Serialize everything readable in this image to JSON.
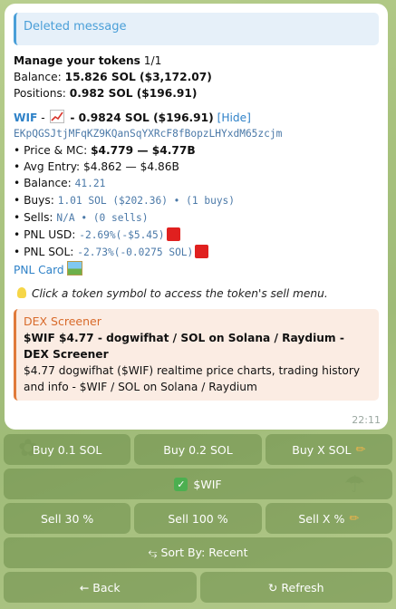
{
  "reply": {
    "text": "Deleted message"
  },
  "manage": {
    "title": "Manage your tokens",
    "pages": "1/1"
  },
  "balance": {
    "label": "Balance:",
    "value": "15.826 SOL ($3,172.07)"
  },
  "positions": {
    "label": "Positions:",
    "value": "0.982 SOL ($196.91)"
  },
  "token": {
    "symbol": "WIF",
    "dash": "-",
    "chart_icon": "chart-increasing-icon",
    "amount": "- 0.9824 SOL ($196.91)",
    "hide": "[Hide]",
    "address": "EKpQGSJtjMFqKZ9KQanSqYXRcF8fBopzLHYxdM65zcjm",
    "price_label": "• Price & MC:",
    "price_value": "$4.779 — $4.77B",
    "avg_label": "• Avg Entry:",
    "avg_value": "$4.862 — $4.86B",
    "bal_label": "• Balance:",
    "bal_value": "41.21",
    "buys_label": "• Buys:",
    "buys_value": "1.01 SOL ($202.36) • (1 buys)",
    "sells_label": "• Sells:",
    "sells_value": "N/A • (0 sells)",
    "pnl_usd_label": "• PNL USD:",
    "pnl_usd_value": "-2.69%(-$5.45)",
    "pnl_sol_label": "• PNL SOL:",
    "pnl_sol_value": "-2.73%(-0.0275 SOL)",
    "pnl_card": "PNL Card"
  },
  "hint": "Click a token symbol to access the token's sell menu.",
  "preview": {
    "site": "DEX Screener",
    "title": "$WIF $4.77 - dogwifhat / SOL on Solana / Raydium - DEX Screener",
    "desc": "$4.77 dogwifhat ($WIF) realtime price charts, trading history and info - $WIF / SOL on Solana / Raydium"
  },
  "time": "22:11",
  "keyboard": {
    "buy_01": "Buy 0.1 SOL",
    "buy_02": "Buy 0.2 SOL",
    "buy_x": "Buy X SOL",
    "wif": "$WIF",
    "sell_30": "Sell 30 %",
    "sell_100": "Sell 100 %",
    "sell_x": "Sell X %",
    "sort": "⥃ Sort By: Recent",
    "back": "← Back",
    "refresh": "Refresh"
  },
  "colors": {
    "accent": "#2f82c8",
    "red_flag": "#e0201f",
    "button_bg": "#6c8c48",
    "preview_accent": "#e07a3a"
  }
}
